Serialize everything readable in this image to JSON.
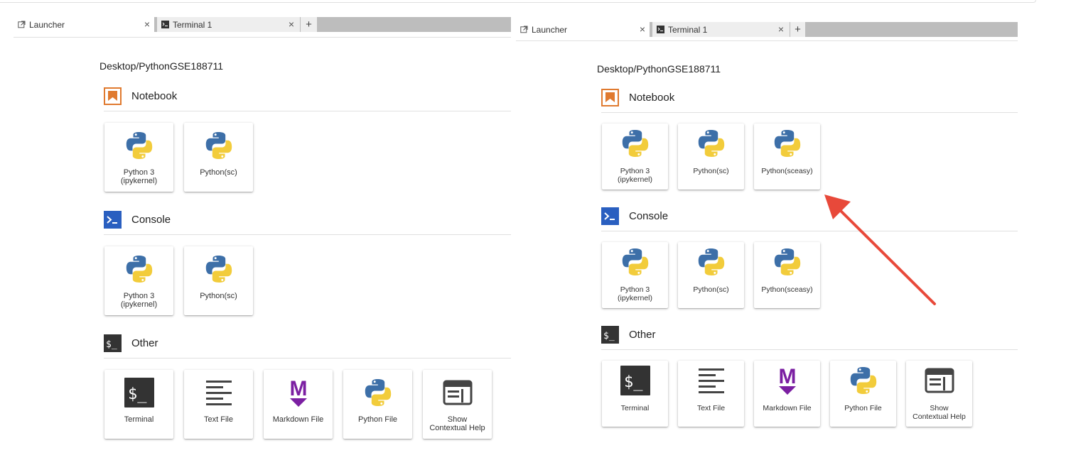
{
  "tabs": {
    "launcher": "Launcher",
    "terminal": "Terminal 1",
    "close_glyph": "×",
    "add_glyph": "+"
  },
  "launcher": {
    "cwd": "Desktop/PythonGSE188711",
    "sections": {
      "notebook": "Notebook",
      "console": "Console",
      "other": "Other"
    }
  },
  "left": {
    "notebook_kernels": [
      "Python 3\n(ipykernel)",
      "Python(sc)"
    ],
    "console_kernels": [
      "Python 3\n(ipykernel)",
      "Python(sc)"
    ],
    "other_items": [
      "Terminal",
      "Text File",
      "Markdown File",
      "Python File",
      "Show\nContextual Help"
    ]
  },
  "right": {
    "notebook_kernels": [
      "Python 3\n(ipykernel)",
      "Python(sc)",
      "Python(sceasy)"
    ],
    "console_kernels": [
      "Python 3\n(ipykernel)",
      "Python(sc)",
      "Python(sceasy)"
    ],
    "other_items": [
      "Terminal",
      "Text File",
      "Markdown File",
      "Python File",
      "Show\nContextual Help"
    ]
  },
  "icons": {
    "launcher_tab": "external-launch-icon",
    "terminal_tab": "terminal-icon",
    "notebook_section": "bookmark-icon",
    "console_section": "console-prompt-icon",
    "other_section": "terminal-prompt-icon",
    "kernel": "python-logo-icon",
    "markdown": "markdown-m-icon",
    "help": "contextual-help-icon",
    "text_file": "text-lines-icon"
  },
  "colors": {
    "notebook_orange": "#e07a2f",
    "console_blue": "#2a5fc0",
    "terminal_dark": "#333333",
    "markdown_purple": "#7b1fa2",
    "python_blue": "#3d6fa8",
    "python_yellow": "#f2cc3b",
    "annotation_arrow": "#e8493a"
  }
}
